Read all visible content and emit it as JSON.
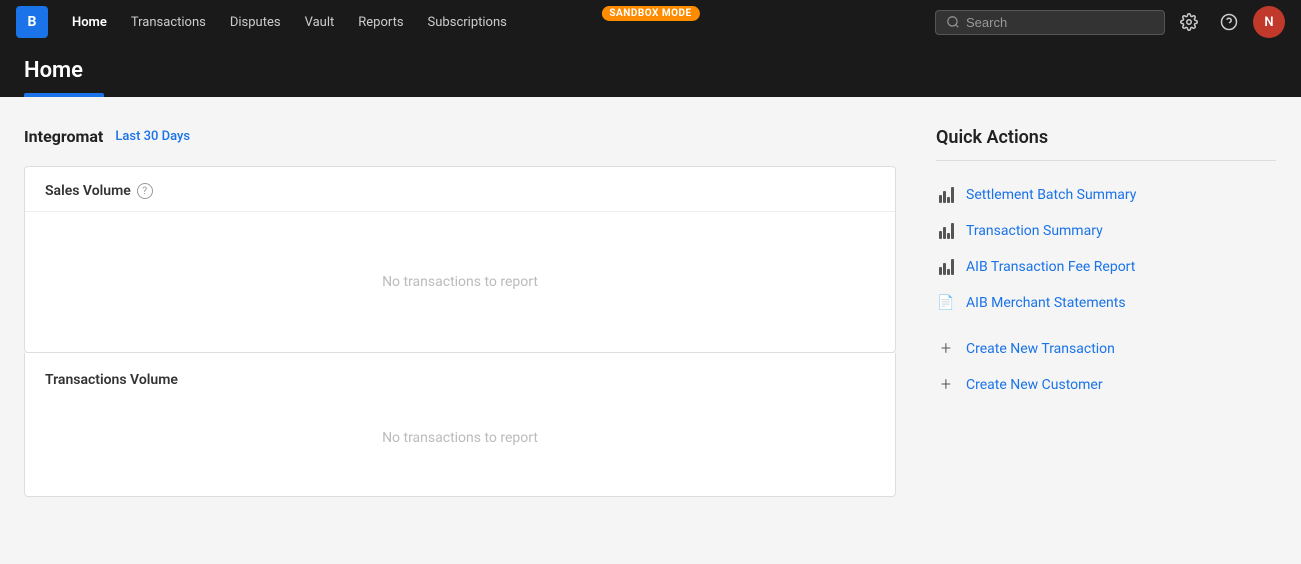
{
  "nav": {
    "logo_letter": "B",
    "sandbox_badge": "SANDBOX MODE",
    "links": [
      {
        "label": "Home",
        "active": true
      },
      {
        "label": "Transactions",
        "active": false
      },
      {
        "label": "Disputes",
        "active": false
      },
      {
        "label": "Vault",
        "active": false
      },
      {
        "label": "Reports",
        "active": false
      },
      {
        "label": "Subscriptions",
        "active": false
      }
    ],
    "search_placeholder": "Search",
    "avatar_letter": "N"
  },
  "page": {
    "title": "Home"
  },
  "main": {
    "company_name": "Integromat",
    "last_days_label": "Last 30 Days",
    "sales_volume_label": "Sales Volume",
    "no_transactions_1": "No transactions to report",
    "transactions_volume_label": "Transactions Volume",
    "no_transactions_2": "No transactions to report"
  },
  "quick_actions": {
    "title": "Quick Actions",
    "items": [
      {
        "label": "Settlement Batch Summary",
        "icon_type": "bar",
        "separator_after": false
      },
      {
        "label": "Transaction Summary",
        "icon_type": "bar",
        "separator_after": false
      },
      {
        "label": "AIB Transaction Fee Report",
        "icon_type": "bar",
        "separator_after": false
      },
      {
        "label": "AIB Merchant Statements",
        "icon_type": "doc",
        "separator_after": true
      },
      {
        "label": "Create New Transaction",
        "icon_type": "plus",
        "separator_after": false
      },
      {
        "label": "Create New Customer",
        "icon_type": "plus",
        "separator_after": false
      }
    ]
  }
}
